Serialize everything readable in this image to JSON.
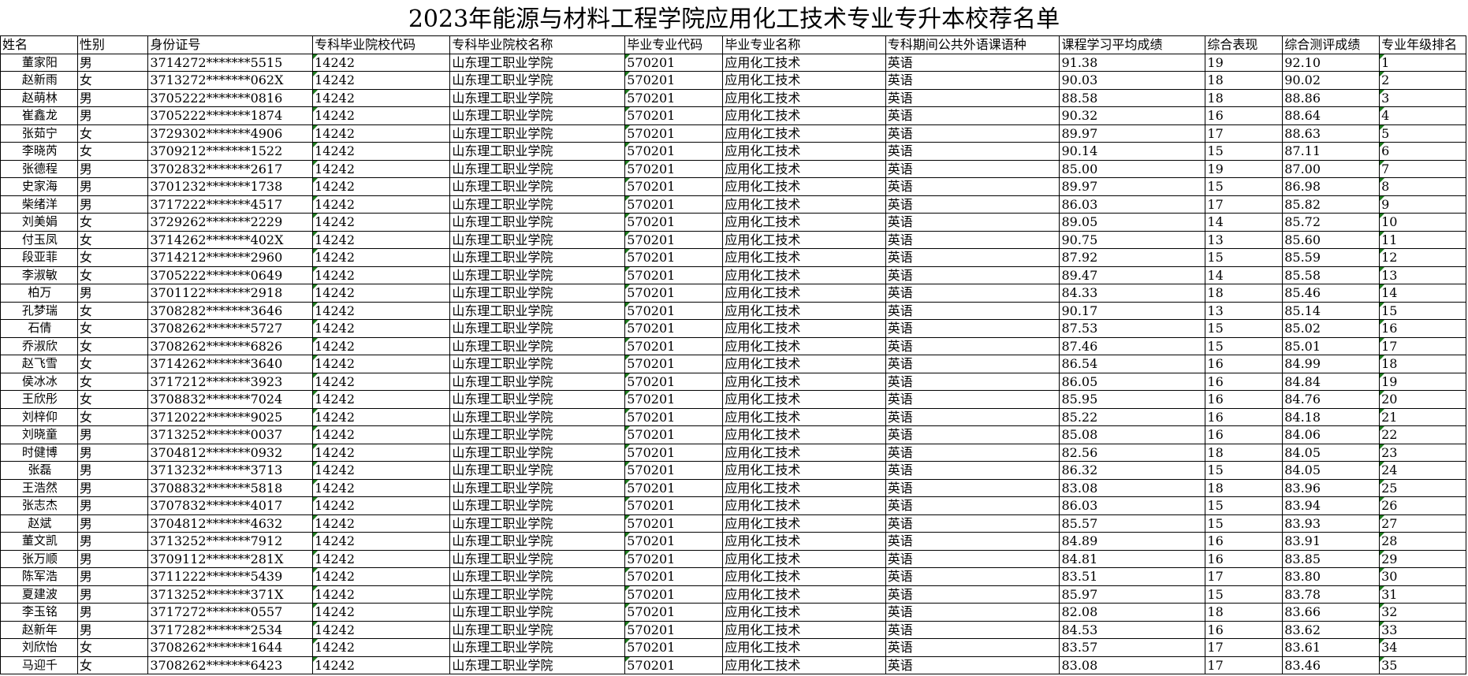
{
  "title": "2023年能源与材料工程学院应用化工技术专业专升本校荐名单",
  "headers": [
    "姓名",
    "性别",
    "身份证号",
    "专科毕业院校代码",
    "专科毕业院校名称",
    "毕业专业代码",
    "毕业专业名称",
    "专科期间公共外语课语种",
    "课程学习平均成绩",
    "综合表现",
    "综合测评成绩",
    "专业年级排名"
  ],
  "rows": [
    [
      "董家阳",
      "男",
      "3714272*******5515",
      "14242",
      "山东理工职业学院",
      "570201",
      "应用化工技术",
      "英语",
      "91.38",
      "19",
      "92.10",
      "1"
    ],
    [
      "赵新雨",
      "女",
      "3713272*******062X",
      "14242",
      "山东理工职业学院",
      "570201",
      "应用化工技术",
      "英语",
      "90.03",
      "18",
      "90.02",
      "2"
    ],
    [
      "赵萌林",
      "男",
      "3705222*******0816",
      "14242",
      "山东理工职业学院",
      "570201",
      "应用化工技术",
      "英语",
      "88.58",
      "18",
      "88.86",
      "3"
    ],
    [
      "崔鑫龙",
      "男",
      "3705222*******1874",
      "14242",
      "山东理工职业学院",
      "570201",
      "应用化工技术",
      "英语",
      "90.32",
      "16",
      "88.64",
      "4"
    ],
    [
      "张茹宁",
      "女",
      "3729302*******4906",
      "14242",
      "山东理工职业学院",
      "570201",
      "应用化工技术",
      "英语",
      "89.97",
      "17",
      "88.63",
      "5"
    ],
    [
      "李晓芮",
      "女",
      "3709212*******1522",
      "14242",
      "山东理工职业学院",
      "570201",
      "应用化工技术",
      "英语",
      "90.14",
      "15",
      "87.11",
      "6"
    ],
    [
      "张德程",
      "男",
      "3702832*******2617",
      "14242",
      "山东理工职业学院",
      "570201",
      "应用化工技术",
      "英语",
      "85.00",
      "19",
      "87.00",
      "7"
    ],
    [
      "史家海",
      "男",
      "3701232*******1738",
      "14242",
      "山东理工职业学院",
      "570201",
      "应用化工技术",
      "英语",
      "89.97",
      "15",
      "86.98",
      "8"
    ],
    [
      "柴绪洋",
      "男",
      "3717222*******4517",
      "14242",
      "山东理工职业学院",
      "570201",
      "应用化工技术",
      "英语",
      "86.03",
      "17",
      "85.82",
      "9"
    ],
    [
      "刘美娟",
      "女",
      "3729262*******2229",
      "14242",
      "山东理工职业学院",
      "570201",
      "应用化工技术",
      "英语",
      "89.05",
      "14",
      "85.72",
      "10"
    ],
    [
      "付玉凤",
      "女",
      "3714262*******402X",
      "14242",
      "山东理工职业学院",
      "570201",
      "应用化工技术",
      "英语",
      "90.75",
      "13",
      "85.60",
      "11"
    ],
    [
      "段亚菲",
      "女",
      "3714212*******2960",
      "14242",
      "山东理工职业学院",
      "570201",
      "应用化工技术",
      "英语",
      "87.92",
      "15",
      "85.59",
      "12"
    ],
    [
      "李淑敏",
      "女",
      "3705222*******0649",
      "14242",
      "山东理工职业学院",
      "570201",
      "应用化工技术",
      "英语",
      "89.47",
      "14",
      "85.58",
      "13"
    ],
    [
      "柏万",
      "男",
      "3701122*******2918",
      "14242",
      "山东理工职业学院",
      "570201",
      "应用化工技术",
      "英语",
      "84.33",
      "18",
      "85.46",
      "14"
    ],
    [
      "孔梦瑞",
      "女",
      "3708282*******3646",
      "14242",
      "山东理工职业学院",
      "570201",
      "应用化工技术",
      "英语",
      "90.17",
      "13",
      "85.14",
      "15"
    ],
    [
      "石倩",
      "女",
      "3708262*******5727",
      "14242",
      "山东理工职业学院",
      "570201",
      "应用化工技术",
      "英语",
      "87.53",
      "15",
      "85.02",
      "16"
    ],
    [
      "乔淑欣",
      "女",
      "3708262*******6826",
      "14242",
      "山东理工职业学院",
      "570201",
      "应用化工技术",
      "英语",
      "87.46",
      "15",
      "85.01",
      "17"
    ],
    [
      "赵飞雪",
      "女",
      "3714262*******3640",
      "14242",
      "山东理工职业学院",
      "570201",
      "应用化工技术",
      "英语",
      "86.54",
      "16",
      "84.99",
      "18"
    ],
    [
      "侯冰冰",
      "女",
      "3717212*******3923",
      "14242",
      "山东理工职业学院",
      "570201",
      "应用化工技术",
      "英语",
      "86.05",
      "16",
      "84.84",
      "19"
    ],
    [
      "王欣彤",
      "女",
      "3708832*******7024",
      "14242",
      "山东理工职业学院",
      "570201",
      "应用化工技术",
      "英语",
      "85.95",
      "16",
      "84.76",
      "20"
    ],
    [
      "刘梓仰",
      "女",
      "3712022*******9025",
      "14242",
      "山东理工职业学院",
      "570201",
      "应用化工技术",
      "英语",
      "85.22",
      "16",
      "84.18",
      "21"
    ],
    [
      "刘晓童",
      "男",
      "3713252*******0037",
      "14242",
      "山东理工职业学院",
      "570201",
      "应用化工技术",
      "英语",
      "85.08",
      "16",
      "84.06",
      "22"
    ],
    [
      "时健博",
      "男",
      "3704812*******0932",
      "14242",
      "山东理工职业学院",
      "570201",
      "应用化工技术",
      "英语",
      "82.56",
      "18",
      "84.05",
      "23"
    ],
    [
      "张磊",
      "男",
      "3713232*******3713",
      "14242",
      "山东理工职业学院",
      "570201",
      "应用化工技术",
      "英语",
      "86.32",
      "15",
      "84.05",
      "24"
    ],
    [
      "王浩然",
      "男",
      "3708832*******5818",
      "14242",
      "山东理工职业学院",
      "570201",
      "应用化工技术",
      "英语",
      "83.08",
      "18",
      "83.96",
      "25"
    ],
    [
      "张志杰",
      "男",
      "3707832*******4017",
      "14242",
      "山东理工职业学院",
      "570201",
      "应用化工技术",
      "英语",
      "86.03",
      "15",
      "83.94",
      "26"
    ],
    [
      "赵斌",
      "男",
      "3704812*******4632",
      "14242",
      "山东理工职业学院",
      "570201",
      "应用化工技术",
      "英语",
      "85.57",
      "15",
      "83.93",
      "27"
    ],
    [
      "董文凯",
      "男",
      "3713252*******7912",
      "14242",
      "山东理工职业学院",
      "570201",
      "应用化工技术",
      "英语",
      "84.89",
      "16",
      "83.91",
      "28"
    ],
    [
      "张万顺",
      "男",
      "3709112*******281X",
      "14242",
      "山东理工职业学院",
      "570201",
      "应用化工技术",
      "英语",
      "84.81",
      "16",
      "83.85",
      "29"
    ],
    [
      "陈军浩",
      "男",
      "3711222*******5439",
      "14242",
      "山东理工职业学院",
      "570201",
      "应用化工技术",
      "英语",
      "83.51",
      "17",
      "83.80",
      "30"
    ],
    [
      "夏建波",
      "男",
      "3713252*******371X",
      "14242",
      "山东理工职业学院",
      "570201",
      "应用化工技术",
      "英语",
      "85.97",
      "15",
      "83.78",
      "31"
    ],
    [
      "李玉铭",
      "男",
      "3717272*******0557",
      "14242",
      "山东理工职业学院",
      "570201",
      "应用化工技术",
      "英语",
      "82.08",
      "18",
      "83.66",
      "32"
    ],
    [
      "赵新年",
      "男",
      "3717282*******2534",
      "14242",
      "山东理工职业学院",
      "570201",
      "应用化工技术",
      "英语",
      "84.53",
      "16",
      "83.62",
      "33"
    ],
    [
      "刘欣怡",
      "女",
      "3708262*******1644",
      "14242",
      "山东理工职业学院",
      "570201",
      "应用化工技术",
      "英语",
      "83.57",
      "17",
      "83.61",
      "34"
    ],
    [
      "马迎千",
      "女",
      "3708262*******6423",
      "14242",
      "山东理工职业学院",
      "570201",
      "应用化工技术",
      "英语",
      "83.08",
      "17",
      "83.46",
      "35"
    ]
  ]
}
